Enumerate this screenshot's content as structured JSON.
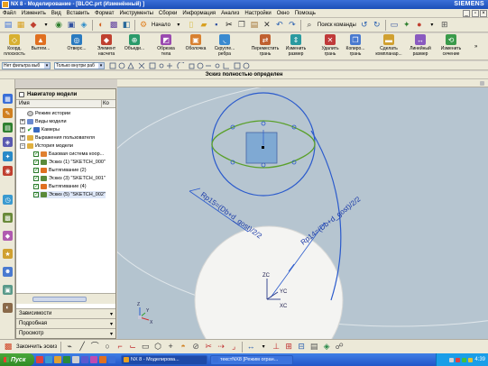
{
  "window": {
    "title": "NX 8 - Моделирование - [BLOC.prt (Изменённый) ]",
    "brand": "SIEMENS"
  },
  "menu": {
    "items": [
      "Файл",
      "Изменить",
      "Вид",
      "Вставить",
      "Формат",
      "Инструменты",
      "Сборки",
      "Информация",
      "Анализ",
      "Настройки",
      "Окно",
      "Помощь"
    ]
  },
  "toolbar": {
    "start_label": "Начало",
    "command_finder_label": "Поиск команды"
  },
  "feature_toolbar": {
    "items": [
      {
        "label": "Коорд.\nплоскость"
      },
      {
        "label": "Вытяги..."
      },
      {
        "label": "Отверс..."
      },
      {
        "label": "Элемент\nнасчета"
      },
      {
        "label": "Объеди..."
      },
      {
        "label": "Обрезка\nтела"
      },
      {
        "label": "Оболочка"
      },
      {
        "label": "Скругле...\nребра"
      },
      {
        "label": "Переместить\nгрань"
      },
      {
        "label": "Изменить\nразмер"
      },
      {
        "label": "Удалить\nгрань"
      },
      {
        "label": "Копиро...\nгрань"
      },
      {
        "label": "Сделать\nкомпланар..."
      },
      {
        "label": "Линейный\nразмер"
      },
      {
        "label": "Изменить\nсечение"
      }
    ]
  },
  "selection": {
    "filter_value": "Нет фильтра выб",
    "scope_value": "Только внутри раб"
  },
  "status": {
    "text": "Эскиз полностью определен"
  },
  "navigator": {
    "title": "Навигатор модели",
    "columns": [
      "Имя",
      "Ко"
    ],
    "tree": [
      {
        "label": "Режим истории",
        "level": 0,
        "expand": "",
        "check": false,
        "icon": "history-mode"
      },
      {
        "label": "Виды модели",
        "level": 0,
        "expand": "+",
        "check": false,
        "icon": "model-views"
      },
      {
        "label": "Камеры",
        "level": 0,
        "expand": "+",
        "check": true,
        "icon": "cameras"
      },
      {
        "label": "Выражения пользователя",
        "level": 0,
        "expand": "+",
        "check": false,
        "icon": "user-expressions"
      },
      {
        "label": "История модели",
        "level": 0,
        "expand": "−",
        "check": false,
        "icon": "model-history"
      },
      {
        "label": "Базовая система коор...",
        "level": 1,
        "expand": "",
        "check": true,
        "icon": "datum-csys"
      },
      {
        "label": "Эскиз (1) \"SKETCH_000\"",
        "level": 1,
        "expand": "",
        "check": true,
        "icon": "sketch"
      },
      {
        "label": "Вытягивание (2)",
        "level": 1,
        "expand": "",
        "check": true,
        "icon": "extrude"
      },
      {
        "label": "Эскиз (3) \"SKETCH_001\"",
        "level": 1,
        "expand": "",
        "check": true,
        "icon": "sketch"
      },
      {
        "label": "Вытягивание (4)",
        "level": 1,
        "expand": "",
        "check": true,
        "icon": "extrude"
      },
      {
        "label": "Эскиз (5) \"SKETCH_002\"",
        "level": 1,
        "expand": "",
        "check": true,
        "icon": "sketch"
      }
    ],
    "panels": [
      "Зависимости",
      "Подробная",
      "Просмотр"
    ]
  },
  "graphics": {
    "dimension_1": "Rp15=(Db+d_gost)/2/2",
    "dimension_2": "Rp14=(Db+d_gost)/2/2",
    "axis_zc": "ZC",
    "axis_xc": "XC",
    "axis_yc": "YC",
    "triad_z": "Z",
    "triad_x": "X",
    "triad_y": "Y",
    "colors": {
      "background": "#b4c4cf",
      "solid": "#f4f4f2",
      "sketch_blue": "#2a5acc",
      "profile_green": "#5aa02a"
    }
  },
  "sketch_toolbar": {
    "finish_label": "Закончить эскиз"
  },
  "taskbar": {
    "start_label": "Пуск",
    "tasks": [
      {
        "label": "NX 8 - Моделирова...",
        "active": true
      },
      {
        "label": "текстNX8 [Режим огран...",
        "active": false
      }
    ],
    "clock": "4:39"
  }
}
